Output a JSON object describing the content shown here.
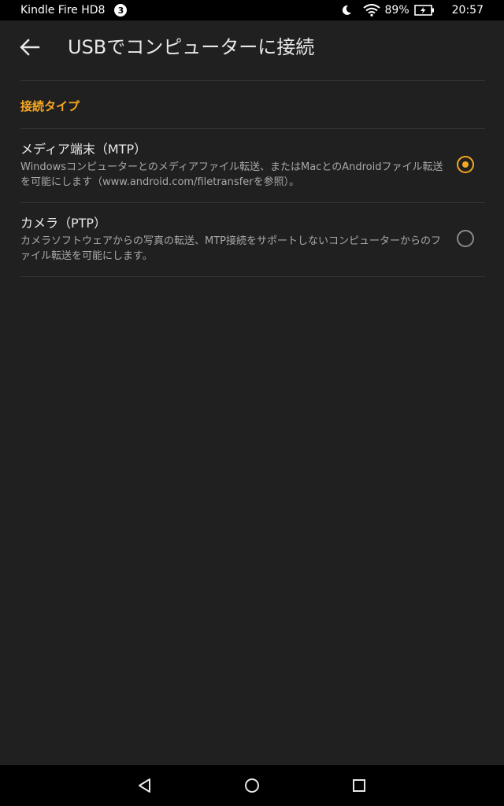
{
  "status_bar": {
    "device_name": "Kindle Fire HD8",
    "notification_count": "3",
    "battery_percent": "89%",
    "time": "20:57",
    "icons": [
      "moon-icon",
      "wifi-icon",
      "battery-charging-icon"
    ]
  },
  "header": {
    "title": "USBでコンピューターに接続",
    "back_icon": "arrow-left-icon"
  },
  "section": {
    "title": "接続タイプ"
  },
  "options": [
    {
      "title": "メディア端末（MTP）",
      "description": "Windowsコンピューターとのメディアファイル転送、またはMacとのAndroidファイル転送を可能にします（www.android.com/filetransferを参照）。",
      "selected": true
    },
    {
      "title": "カメラ（PTP）",
      "description": "カメラソフトウェアからの写真の転送、MTP接続をサポートしないコンピューターからのファイル転送を可能にします。",
      "selected": false
    }
  ],
  "nav_bar": {
    "icons": [
      "back-triangle-icon",
      "home-circle-icon",
      "recents-square-icon"
    ]
  },
  "colors": {
    "accent": "#f5a623",
    "background": "#202020",
    "bars": "#000000"
  }
}
